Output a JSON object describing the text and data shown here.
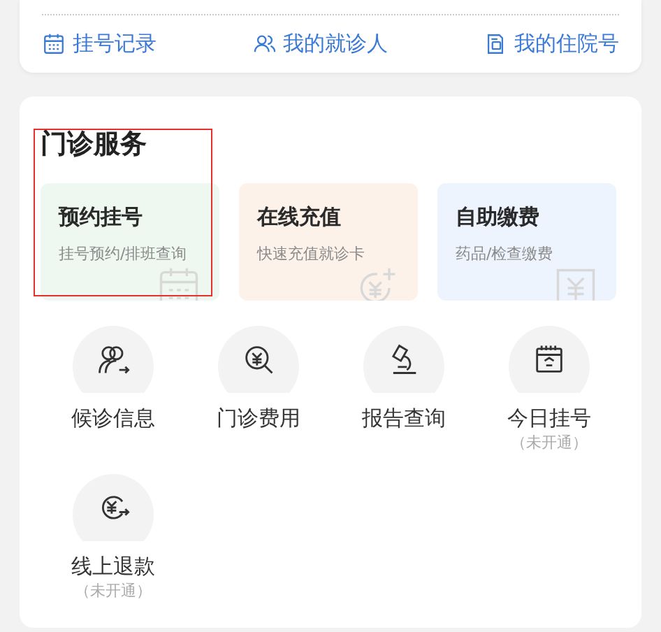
{
  "top_links": [
    {
      "label": "挂号记录"
    },
    {
      "label": "我的就诊人"
    },
    {
      "label": "我的住院号"
    }
  ],
  "outpatient": {
    "title": "门诊服务",
    "highlight_frame": true,
    "cards": [
      {
        "title": "预约挂号",
        "subtitle": "挂号预约/排班查询"
      },
      {
        "title": "在线充值",
        "subtitle": "快速充值就诊卡"
      },
      {
        "title": "自助缴费",
        "subtitle": "药品/检查缴费"
      }
    ],
    "services": [
      {
        "label": "候诊信息"
      },
      {
        "label": "门诊费用"
      },
      {
        "label": "报告查询"
      },
      {
        "label": "今日挂号",
        "note": "（未开通）"
      },
      {
        "label": "线上退款",
        "note": "（未开通）"
      }
    ]
  }
}
